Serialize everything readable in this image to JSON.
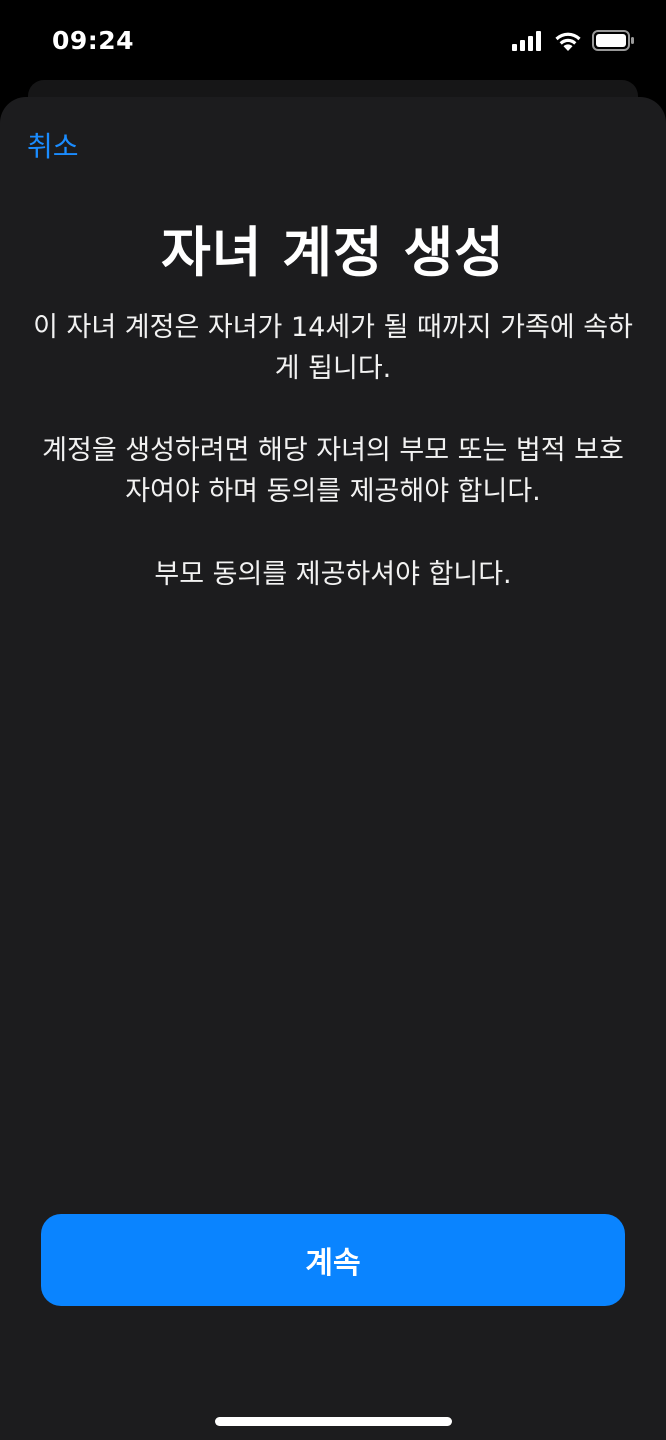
{
  "status_bar": {
    "time": "09:24",
    "icons": [
      "cellular-signal-icon",
      "wifi-icon",
      "battery-icon"
    ]
  },
  "nav": {
    "cancel_label": "취소"
  },
  "content": {
    "title": "자녀 계정 생성",
    "paragraph_1": "이 자녀 계정은 자녀가 14세가 될 때까지 가족에 속하게 됩니다.",
    "paragraph_2": "계정을 생성하려면 해당 자녀의 부모 또는 법적 보호자여야 하며 동의를 제공해야 합니다.",
    "paragraph_3": "부모 동의를 제공하셔야 합니다."
  },
  "actions": {
    "continue_label": "계속"
  },
  "colors": {
    "accent": "#0a84ff",
    "link": "#1a8cff",
    "sheet_background": "#1c1c1e",
    "background": "#000000"
  }
}
